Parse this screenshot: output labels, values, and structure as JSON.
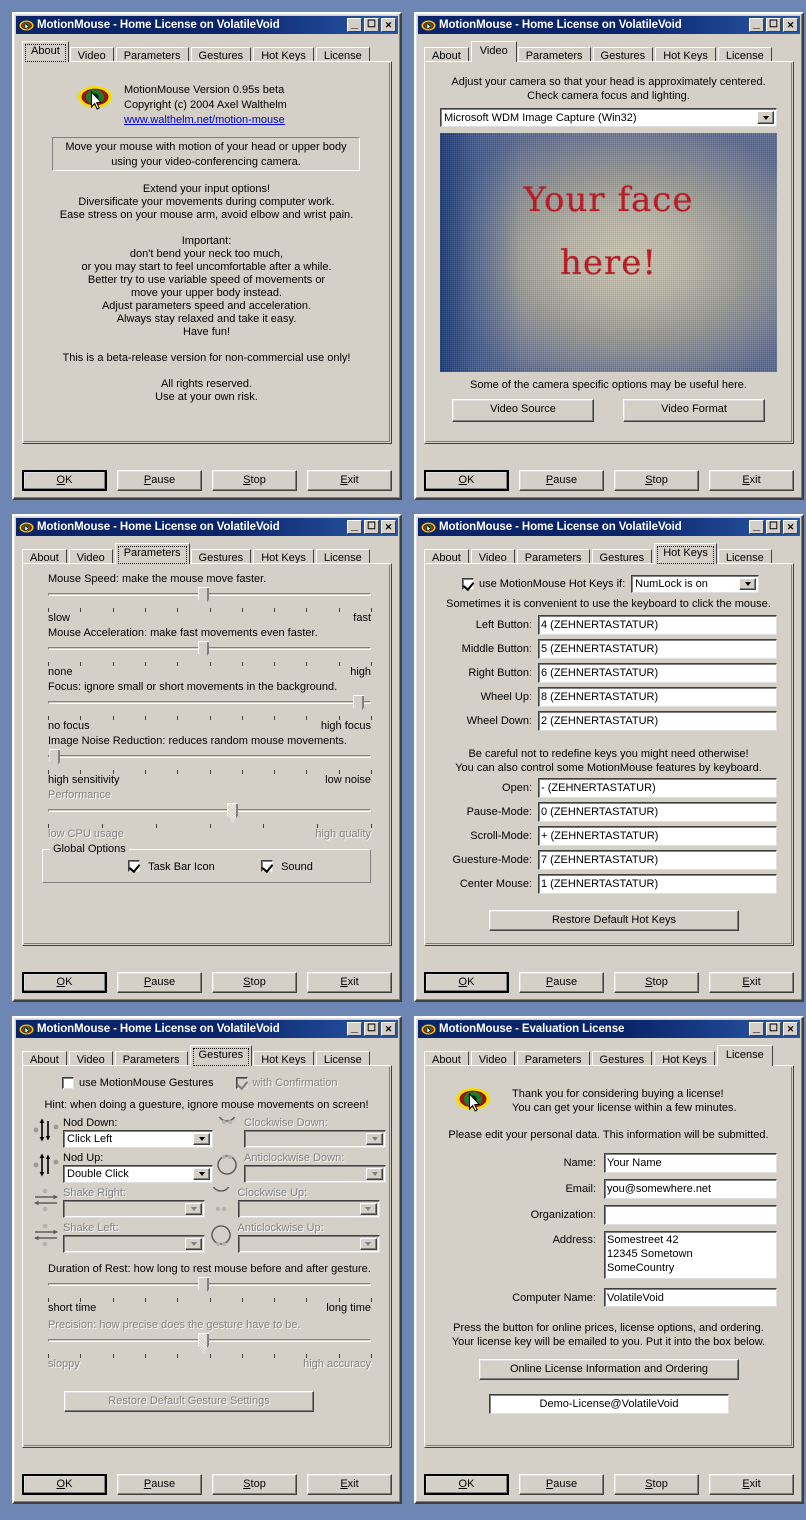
{
  "app": {
    "title_home": "MotionMouse - Home License on VolatileVoid",
    "title_eval": "MotionMouse - Evaluation License",
    "icon": "eye-logo-icon"
  },
  "titlebar_buttons": {
    "minimize": "_",
    "maximize": "☐",
    "close": "✕"
  },
  "tabs": [
    "About",
    "Video",
    "Parameters",
    "Gestures",
    "Hot Keys",
    "License"
  ],
  "footer": {
    "ok": "OK",
    "ok_acc": "O",
    "pause": "Pause",
    "pause_acc": "P",
    "stop": "Stop",
    "stop_acc": "S",
    "exit": "Exit",
    "exit_acc": "E"
  },
  "about": {
    "version": "MotionMouse Version 0.95s beta",
    "copyright": "Copyright (c) 2004 Axel Walthelm",
    "link": "www.walthelm.net/motion-mouse",
    "link_color": "#0000cc",
    "box_line1": "Move your mouse with motion of your head or upper body",
    "box_line2": "using your video-conferencing camera.",
    "body": [
      "Extend your input options!",
      "Diversificate your movements during computer work.",
      "Ease stress on your mouse arm, avoid elbow and wrist pain.",
      "",
      "Important:",
      "don't bend your neck too much,",
      "or you may start to feel uncomfortable after a while.",
      "Better try to use variable speed of movements or",
      "move your upper body instead.",
      "Adjust parameters speed and acceleration.",
      "Always stay relaxed and take it easy.",
      "Have fun!",
      "",
      "This is a beta-release version for non-commercial use only!",
      "",
      "All rights reserved.",
      "Use at your own risk."
    ]
  },
  "video": {
    "hint1": "Adjust your camera so that your head is approximately centered.",
    "hint2": "Check camera focus and lighting.",
    "device": "Microsoft WDM Image Capture (Win32)",
    "preview_line1": "Your face",
    "preview_line2": "here!",
    "preview_text_color": "#c1121b",
    "note": "Some of the camera specific options may be useful here.",
    "btn_source": "Video Source",
    "btn_format": "Video Format"
  },
  "parameters": {
    "sliders": [
      {
        "label": "Mouse Speed: make the mouse move faster.",
        "left": "slow",
        "right": "fast",
        "value_pct": 48,
        "ticks": 11,
        "disabled": false
      },
      {
        "label": "Mouse Acceleration: make fast movements even faster.",
        "left": "none",
        "right": "high",
        "value_pct": 48,
        "ticks": 11,
        "disabled": false
      },
      {
        "label": "Focus: ignore small or short movements in the background.",
        "left": "no focus",
        "right": "high focus",
        "value_pct": 96,
        "ticks": 11,
        "disabled": false
      },
      {
        "label": "Image Noise Reduction: reduces random mouse movements.",
        "left": "high sensitivity",
        "right": "low noise",
        "value_pct": 2,
        "ticks": 11,
        "disabled": false
      },
      {
        "label": "Performance",
        "left": "low CPU usage",
        "right": "high quality",
        "value_pct": 57,
        "ticks": 7,
        "disabled": true
      }
    ],
    "group_title": "Global Options",
    "chk_taskbar": {
      "label": "Task Bar Icon",
      "checked": true
    },
    "chk_sound": {
      "label": "Sound",
      "checked": true
    }
  },
  "hotkeys": {
    "enable_label": "use MotionMouse Hot Keys if:",
    "enable_checked": true,
    "condition": "NumLock is on",
    "hint": "Sometimes it is convenient to use the keyboard to click the mouse.",
    "fields_top": [
      {
        "label": "Left Button:",
        "value": "4 (ZEHNERTASTATUR)"
      },
      {
        "label": "Middle Button:",
        "value": "5 (ZEHNERTASTATUR)"
      },
      {
        "label": "Right Button:",
        "value": "6 (ZEHNERTASTATUR)"
      },
      {
        "label": "Wheel Up:",
        "value": "8 (ZEHNERTASTATUR)"
      },
      {
        "label": "Wheel Down:",
        "value": "2 (ZEHNERTASTATUR)"
      }
    ],
    "warn1": "Be careful not to redefine keys you might need otherwise!",
    "warn2": "You can also control some MotionMouse features by keyboard.",
    "fields_bottom": [
      {
        "label": "Open:",
        "value": "- (ZEHNERTASTATUR)"
      },
      {
        "label": "Pause-Mode:",
        "value": "0 (ZEHNERTASTATUR)"
      },
      {
        "label": "Scroll-Mode:",
        "value": "+ (ZEHNERTASTATUR)"
      },
      {
        "label": "Guesture-Mode:",
        "value": "7 (ZEHNERTASTATUR)"
      },
      {
        "label": "Center Mouse:",
        "value": "1 (ZEHNERTASTATUR)"
      }
    ],
    "restore_btn": "Restore Default Hot Keys"
  },
  "gestures": {
    "enable_label": "use MotionMouse Gestures",
    "enable_checked": false,
    "confirm_label": "with Confirmation",
    "confirm_checked": true,
    "confirm_disabled": true,
    "hint": "Hint: when doing a guesture, ignore mouse movements on screen!",
    "items": [
      {
        "label": "Nod Down:",
        "value": "Click Left",
        "icon": "nod-down-icon",
        "disabled": false
      },
      {
        "label": "Clockwise Down:",
        "value": "",
        "icon": "clockwise-down-icon",
        "disabled": true
      },
      {
        "label": "Nod Up:",
        "value": "Double Click",
        "icon": "nod-up-icon",
        "disabled": false
      },
      {
        "label": "Anticlockwise Down:",
        "value": "",
        "icon": "anticlockwise-down-icon",
        "disabled": true
      },
      {
        "label": "Shake Right:",
        "value": "",
        "icon": "shake-right-icon",
        "disabled": true
      },
      {
        "label": "Clockwise Up:",
        "value": "",
        "icon": "clockwise-up-icon",
        "disabled": true
      },
      {
        "label": "Shake Left:",
        "value": "",
        "icon": "shake-left-icon",
        "disabled": true
      },
      {
        "label": "Anticlockwise Up:",
        "value": "",
        "icon": "anticlockwise-up-icon",
        "disabled": true
      }
    ],
    "rest_slider": {
      "label": "Duration of Rest: how long to rest mouse before and after gesture.",
      "left": "short time",
      "right": "long time",
      "value_pct": 48,
      "ticks": 11,
      "disabled": false
    },
    "precision_slider": {
      "label": "Precision: how precise does the gesture have to be.",
      "left": "sloppy",
      "right": "high accuracy",
      "value_pct": 48,
      "ticks": 11,
      "disabled": true
    },
    "restore_btn": "Restore Default Gesture Settings"
  },
  "license": {
    "thanks1": "Thank you for considering buying a license!",
    "thanks2": "You can get your license within a few minutes.",
    "edit_note": "Please edit your personal data. This information will be submitted.",
    "fields": [
      {
        "label": "Name:",
        "value": "Your Name"
      },
      {
        "label": "Email:",
        "value": "you@somewhere.net"
      },
      {
        "label": "Organization:",
        "value": ""
      }
    ],
    "address_label": "Address:",
    "address_value": "Somestreet 42\n12345 Sometown\nSomeCountry",
    "computer_label": "Computer Name:",
    "computer_value": "VolatileVoid",
    "press_line1": "Press the button for online prices, license options, and ordering.",
    "press_line2": "Your license key will be emailed to you. Put it into the box below.",
    "order_btn": "Online License Information and Ordering",
    "key_value": "Demo-License@VolatileVoid"
  },
  "colors": {
    "desktop": "#6d86b4",
    "face": "#d4d0c8",
    "title_grad_start": "#0a246a",
    "title_grad_end": "#2a59a8"
  }
}
